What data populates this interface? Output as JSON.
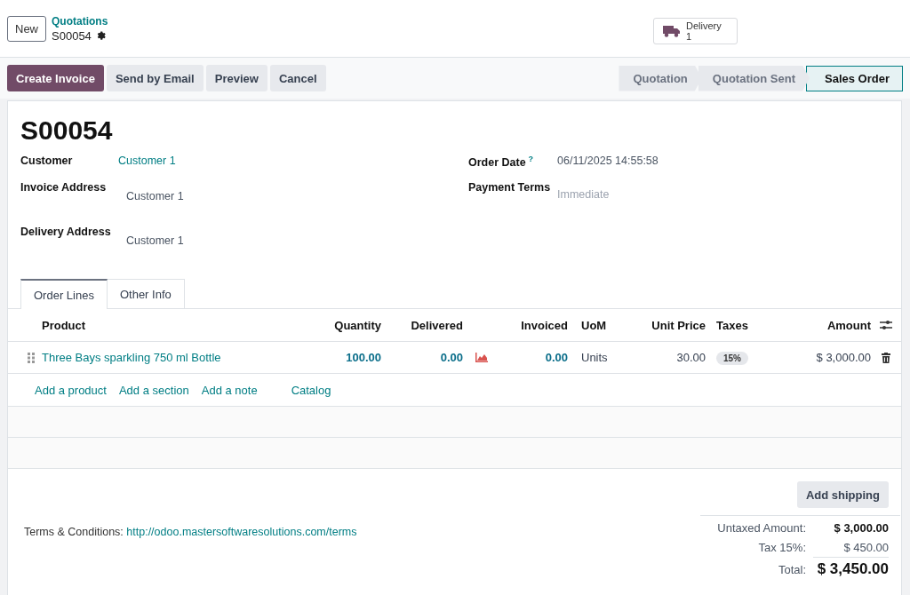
{
  "breadcrumb": {
    "new_button": "New",
    "parent": "Quotations",
    "record": "S00054"
  },
  "smart_button": {
    "label": "Delivery",
    "count": "1"
  },
  "actions": [
    {
      "label": "Create Invoice",
      "kind": "primary"
    },
    {
      "label": "Send by Email",
      "kind": "secondary"
    },
    {
      "label": "Preview",
      "kind": "secondary"
    },
    {
      "label": "Cancel",
      "kind": "secondary"
    }
  ],
  "status_steps": [
    {
      "label": "Quotation",
      "selected": false
    },
    {
      "label": "Quotation Sent",
      "selected": false
    },
    {
      "label": "Sales Order",
      "selected": true
    }
  ],
  "form": {
    "title": "S00054",
    "fields_left": [
      {
        "label": "Customer",
        "value": "Customer 1",
        "kind": "link"
      },
      {
        "label": "Invoice Address",
        "value": "Customer 1",
        "kind": "text"
      },
      {
        "label": "Delivery Address",
        "value": "Customer 1",
        "kind": "text"
      }
    ],
    "fields_right": [
      {
        "label": "Order Date",
        "help": "?",
        "value": "06/11/2025 14:55:58",
        "kind": "text"
      },
      {
        "label": "Payment Terms",
        "placeholder": "Immediate",
        "kind": "empty"
      }
    ]
  },
  "tabs": [
    {
      "label": "Order Lines",
      "selected": true
    },
    {
      "label": "Other Info",
      "selected": false
    }
  ],
  "table": {
    "columns": [
      "Product",
      "Quantity",
      "Delivered",
      "Invoiced",
      "UoM",
      "Unit Price",
      "Taxes",
      "Amount"
    ],
    "rows": [
      {
        "product": "Three Bays sparkling 750 ml Bottle",
        "quantity": "100.00",
        "delivered": "0.00",
        "invoiced": "0.00",
        "uom": "Units",
        "unit_price": "30.00",
        "taxes": [
          "15%"
        ],
        "amount": "$ 3,000.00"
      }
    ],
    "add_links": [
      "Add a product",
      "Add a section",
      "Add a note"
    ],
    "catalog": "Catalog"
  },
  "terms": {
    "label": "Terms & Conditions:",
    "link": "http://odoo.mastersoftwaresolutions.com/terms"
  },
  "add_shipping": "Add shipping",
  "totals": [
    {
      "label": "Untaxed Amount:",
      "value": "$ 3,000.00",
      "kind": "subtotal"
    },
    {
      "label": "Tax 15%:",
      "value": "$ 450.00",
      "kind": "tax"
    },
    {
      "label": "Total:",
      "value": "$ 3,450.00",
      "kind": "total"
    }
  ]
}
